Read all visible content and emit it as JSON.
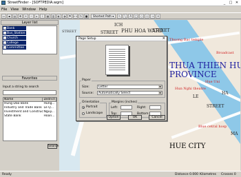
{
  "window": {
    "title": "StreetFinder - [SOFTPEDIA.wgm]",
    "minimize": "_",
    "maximize": "□",
    "close": "✕"
  },
  "menu": [
    "File",
    "View",
    "Window",
    "Help"
  ],
  "toolbar": {
    "shortest_path_label": "Shortest Path",
    "shortest_path_arrow": "▾"
  },
  "layer_panel": {
    "title": "Layer list",
    "check": "✓",
    "layers": [
      {
        "label": "Bank",
        "checked": true
      },
      {
        "label": "Bus_Station",
        "checked": true
      },
      {
        "label": "Church",
        "checked": true
      },
      {
        "label": "College",
        "checked": true
      },
      {
        "label": "Committee",
        "checked": true
      }
    ]
  },
  "favorites": {
    "title": "Favorites"
  },
  "search": {
    "label": "Input a string to search",
    "columns": [
      "Name",
      "District"
    ],
    "results": [
      {
        "name": "Hung Dao Bank",
        "district": "Hung..."
      },
      {
        "name": "Industry and Trade Bank",
        "district": "Le Q..."
      },
      {
        "name": "Investment and Construct...",
        "district": "Nguy..."
      },
      {
        "name": "State Bank",
        "district": "Hoan..."
      }
    ],
    "button": "Search"
  },
  "map": {
    "labels": {
      "phu_hoa": "PHU HOA WARD",
      "ich": "ICH",
      "street1": "STREET",
      "street2": "STREET",
      "street3": "STREET",
      "street_top": "STREET",
      "thuong_bac": "Thuong Bac temple",
      "broadcast": "Broadcast",
      "province1": "THUA THIEN HU",
      "province2": "PROVINCE",
      "hue_uni": "Hue Uni",
      "hung_nghi": "Hun Nghi theatre",
      "le": "LE",
      "ha": "HA",
      "hue_city": "HUE CITY",
      "blue_hosp": "Blue cetral hosp",
      "ma": "MA"
    }
  },
  "dialog": {
    "title": "Page Setup",
    "close": "✕",
    "paper_group": "Paper",
    "size_label": "Size:",
    "size_value": "Letter",
    "source_label": "Source:",
    "source_value": "Automatically Select",
    "orientation_group": "Orientation",
    "portrait": "Portrait",
    "landscape": "Landscape",
    "margins_group": "Margins (inches)",
    "left": "Left:",
    "right": "Right:",
    "top": "Top:",
    "bottom": "Bottom:",
    "option_button": "Option",
    "ok_button": "OK",
    "cancel_button": "Cancel"
  },
  "status": {
    "left": "Ready",
    "distance": "Distance 0.000",
    "unit": "Kilometres",
    "crosses": "Crosses 0"
  }
}
